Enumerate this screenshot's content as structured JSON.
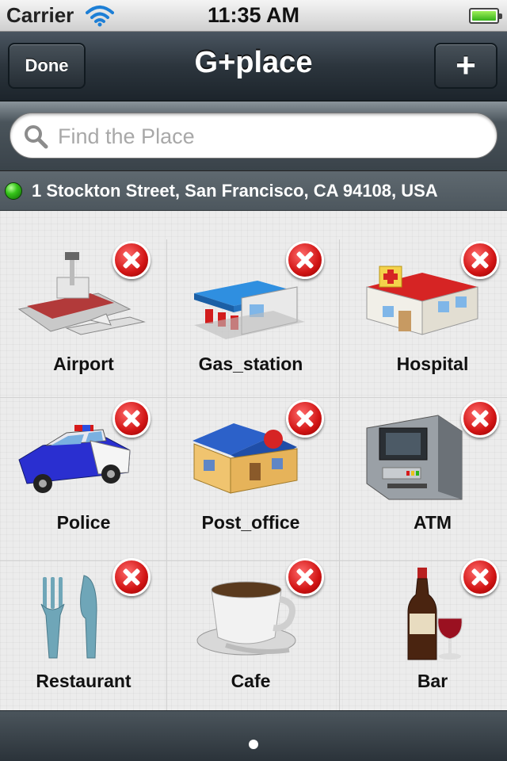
{
  "status_bar": {
    "carrier": "Carrier",
    "time": "11:35 AM",
    "battery_level": 1.0,
    "battery_color": "#35b11a"
  },
  "nav": {
    "title": "G+place",
    "done_label": "Done",
    "add_label": "+"
  },
  "search": {
    "placeholder": "Find the Place",
    "value": "",
    "icon": "search-icon"
  },
  "location": {
    "address": "1 Stockton Street, San Francisco, CA 94108, USA",
    "status_color": "#36c41a"
  },
  "places": [
    {
      "label": "Airport",
      "icon": "airport-icon"
    },
    {
      "label": "Gas_station",
      "icon": "gas-station-icon"
    },
    {
      "label": "Hospital",
      "icon": "hospital-icon"
    },
    {
      "label": "Police",
      "icon": "police-car-icon"
    },
    {
      "label": "Post_office",
      "icon": "post-office-icon"
    },
    {
      "label": "ATM",
      "icon": "atm-icon"
    },
    {
      "label": "Restaurant",
      "icon": "fork-knife-icon"
    },
    {
      "label": "Cafe",
      "icon": "coffee-cup-icon"
    },
    {
      "label": "Bar",
      "icon": "wine-bottle-icon"
    }
  ],
  "pager": {
    "current_page": 1,
    "total_pages": 1
  }
}
